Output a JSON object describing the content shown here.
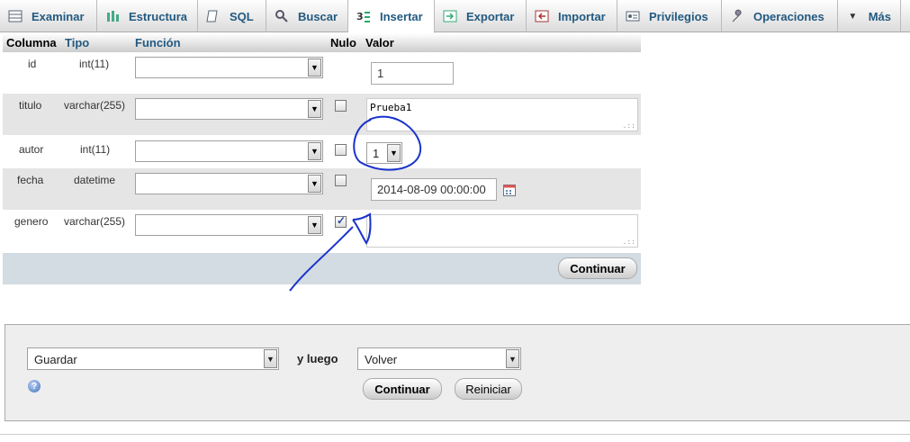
{
  "tabs": [
    {
      "label": "Examinar",
      "icon": "table-browse-icon"
    },
    {
      "label": "Estructura",
      "icon": "structure-icon"
    },
    {
      "label": "SQL",
      "icon": "sql-icon"
    },
    {
      "label": "Buscar",
      "icon": "search-icon"
    },
    {
      "label": "Insertar",
      "icon": "insert-icon"
    },
    {
      "label": "Exportar",
      "icon": "export-icon"
    },
    {
      "label": "Importar",
      "icon": "import-icon"
    },
    {
      "label": "Privilegios",
      "icon": "privileges-icon"
    },
    {
      "label": "Operaciones",
      "icon": "wrench-icon"
    },
    {
      "label": "Más",
      "icon": "triangle-down-icon"
    }
  ],
  "active_tab": "Insertar",
  "headers": {
    "column": "Columna",
    "type": "Tipo",
    "function": "Función",
    "null": "Nulo",
    "value": "Valor"
  },
  "rows": [
    {
      "column": "id",
      "type": "int(11)",
      "value": "1"
    },
    {
      "column": "titulo",
      "type": "varchar(255)",
      "value": "Prueba1"
    },
    {
      "column": "autor",
      "type": "int(11)",
      "value": "1"
    },
    {
      "column": "fecha",
      "type": "datetime",
      "value": "2014-08-09 00:00:00"
    },
    {
      "column": "genero",
      "type": "varchar(255)",
      "value": ""
    }
  ],
  "continue_label": "Continuar",
  "bottom": {
    "action_value": "Guardar",
    "then_label": "y luego",
    "after_value": "Volver",
    "continue_label": "Continuar",
    "reset_label": "Reiniciar"
  },
  "colors": {
    "link_blue": "#235a81",
    "annotation": "#1a33cc",
    "footer_bar": "#d3dce3"
  }
}
